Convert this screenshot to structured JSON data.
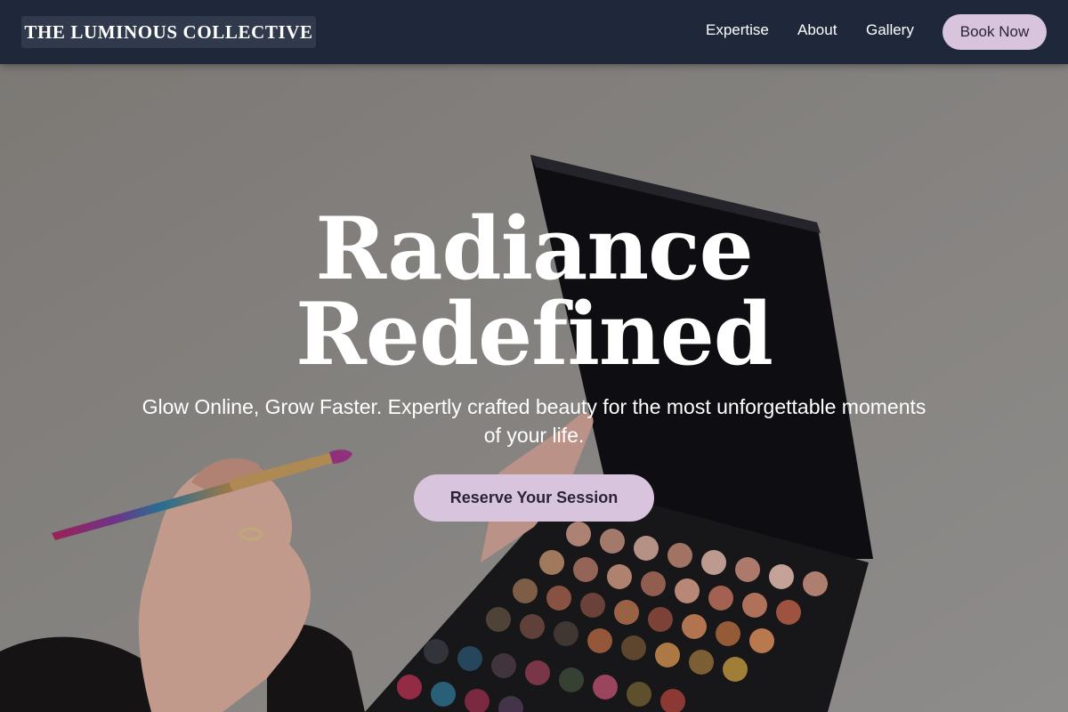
{
  "header": {
    "logo_text": "THE LUMINOUS COLLECTIVE",
    "nav": [
      {
        "label": "Expertise"
      },
      {
        "label": "About"
      },
      {
        "label": "Gallery"
      }
    ],
    "book_button_label": "Book Now"
  },
  "hero": {
    "headline_line1": "Radiance",
    "headline_line2": "Redefined",
    "subtitle": "Glow Online, Grow Faster. Expertly crafted beauty for the most unforgettable moments of your life.",
    "cta_label": "Reserve Your Session",
    "background_image": "makeup-artist-holding-eyeshadow-palette-and-brush"
  },
  "colors": {
    "header_bg": "#1f283b",
    "accent": "#d9c4de",
    "accent_text": "#2b2436",
    "text_light": "#ffffff"
  }
}
